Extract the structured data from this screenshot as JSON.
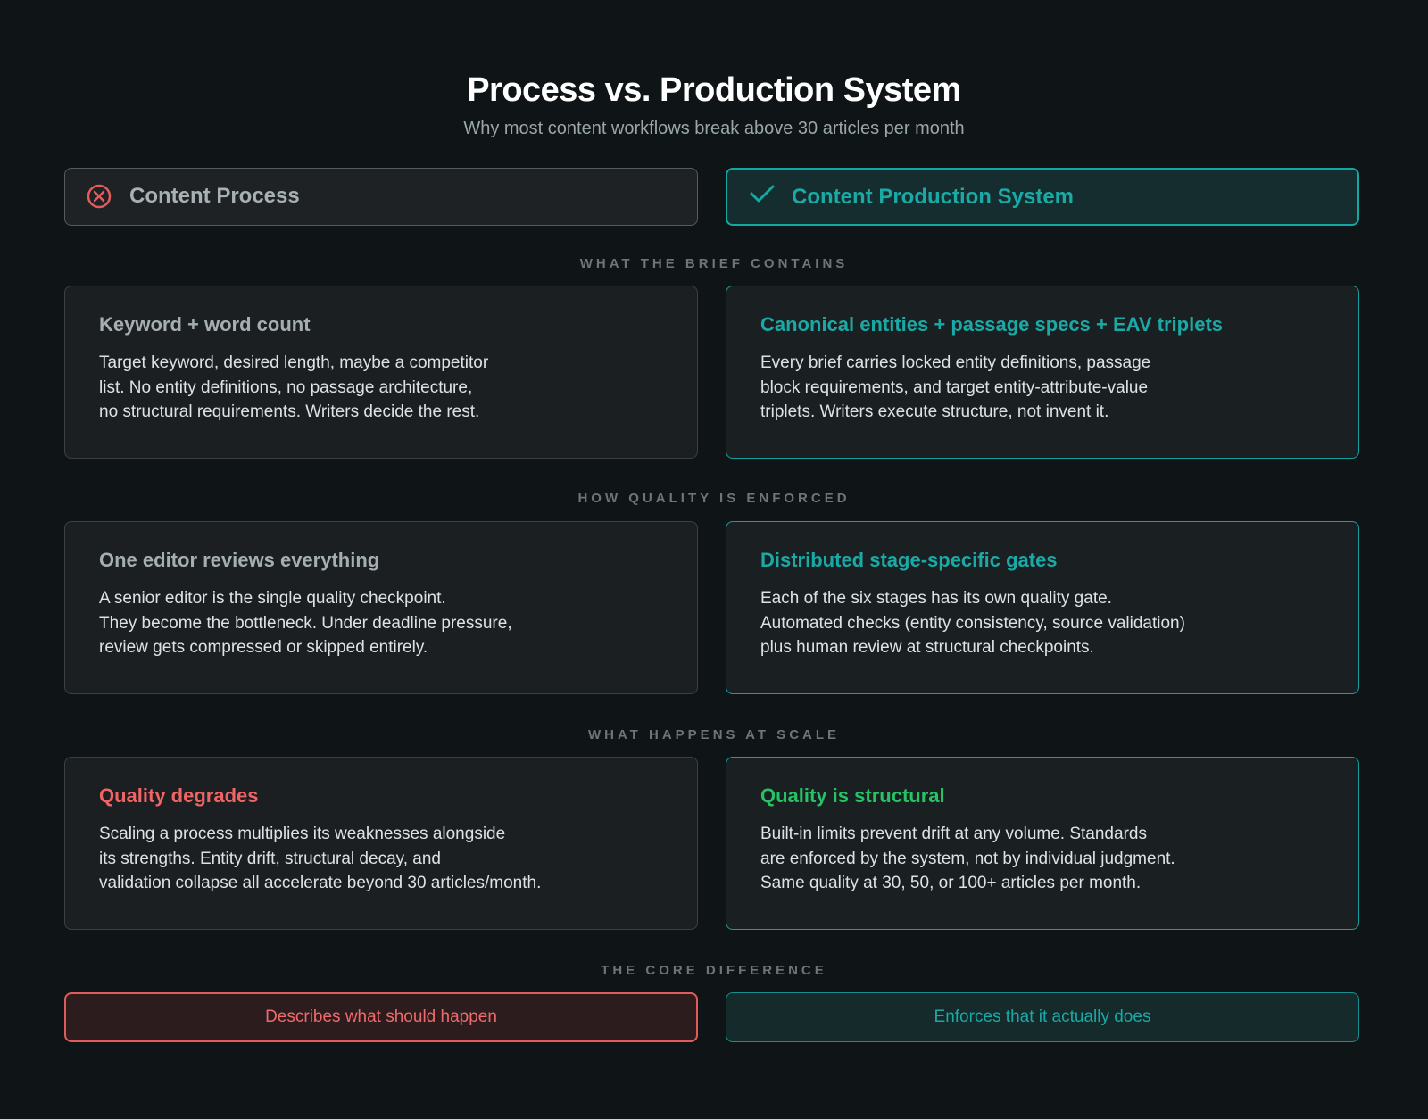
{
  "title": "Process vs. Production System",
  "subtitle": "Why most content workflows break above 30 articles per month",
  "columns": {
    "left": {
      "label": "Content Process",
      "icon": "x-circle-icon",
      "color": "#e25c5c"
    },
    "right": {
      "label": "Content Production System",
      "icon": "check-icon",
      "color": "#14a8a4"
    }
  },
  "sections": [
    {
      "label": "WHAT THE BRIEF CONTAINS",
      "left": {
        "title": "Keyword + word count",
        "lines": [
          "Target keyword, desired length, maybe a competitor",
          "list. No entity definitions, no passage architecture,",
          "no structural requirements. Writers decide the rest."
        ]
      },
      "right": {
        "title": "Canonical entities + passage specs + EAV triplets",
        "lines": [
          "Every brief carries locked entity definitions, passage",
          "block requirements, and target entity-attribute-value",
          "triplets. Writers execute structure, not invent it."
        ]
      }
    },
    {
      "label": "HOW QUALITY IS ENFORCED",
      "left": {
        "title": "One editor reviews everything",
        "lines": [
          "A senior editor is the single quality checkpoint.",
          "They become the bottleneck. Under deadline pressure,",
          "review gets compressed or skipped entirely."
        ]
      },
      "right": {
        "title": "Distributed stage-specific gates",
        "lines": [
          "Each of the six stages has its own quality gate.",
          "Automated checks (entity consistency, source validation)",
          "plus human review at structural checkpoints."
        ]
      }
    },
    {
      "label": "WHAT HAPPENS AT SCALE",
      "left": {
        "title": "Quality degrades",
        "lines": [
          "Scaling a process multiplies its weaknesses alongside",
          "its strengths. Entity drift, structural decay, and",
          "validation collapse all accelerate beyond 30 articles/month."
        ]
      },
      "right": {
        "title": "Quality is structural",
        "lines": [
          "Built-in limits prevent drift at any volume. Standards",
          "are enforced by the system, not by individual judgment.",
          "Same quality at 30, 50, or 100+ articles per month."
        ]
      }
    }
  ],
  "core": {
    "label": "THE CORE DIFFERENCE",
    "left": "Describes what should happen",
    "right": "Enforces that it actually does"
  },
  "colors": {
    "background": "#0f1516",
    "teal": "#1aa9a5",
    "red": "#ef6464",
    "green": "#27c265"
  }
}
